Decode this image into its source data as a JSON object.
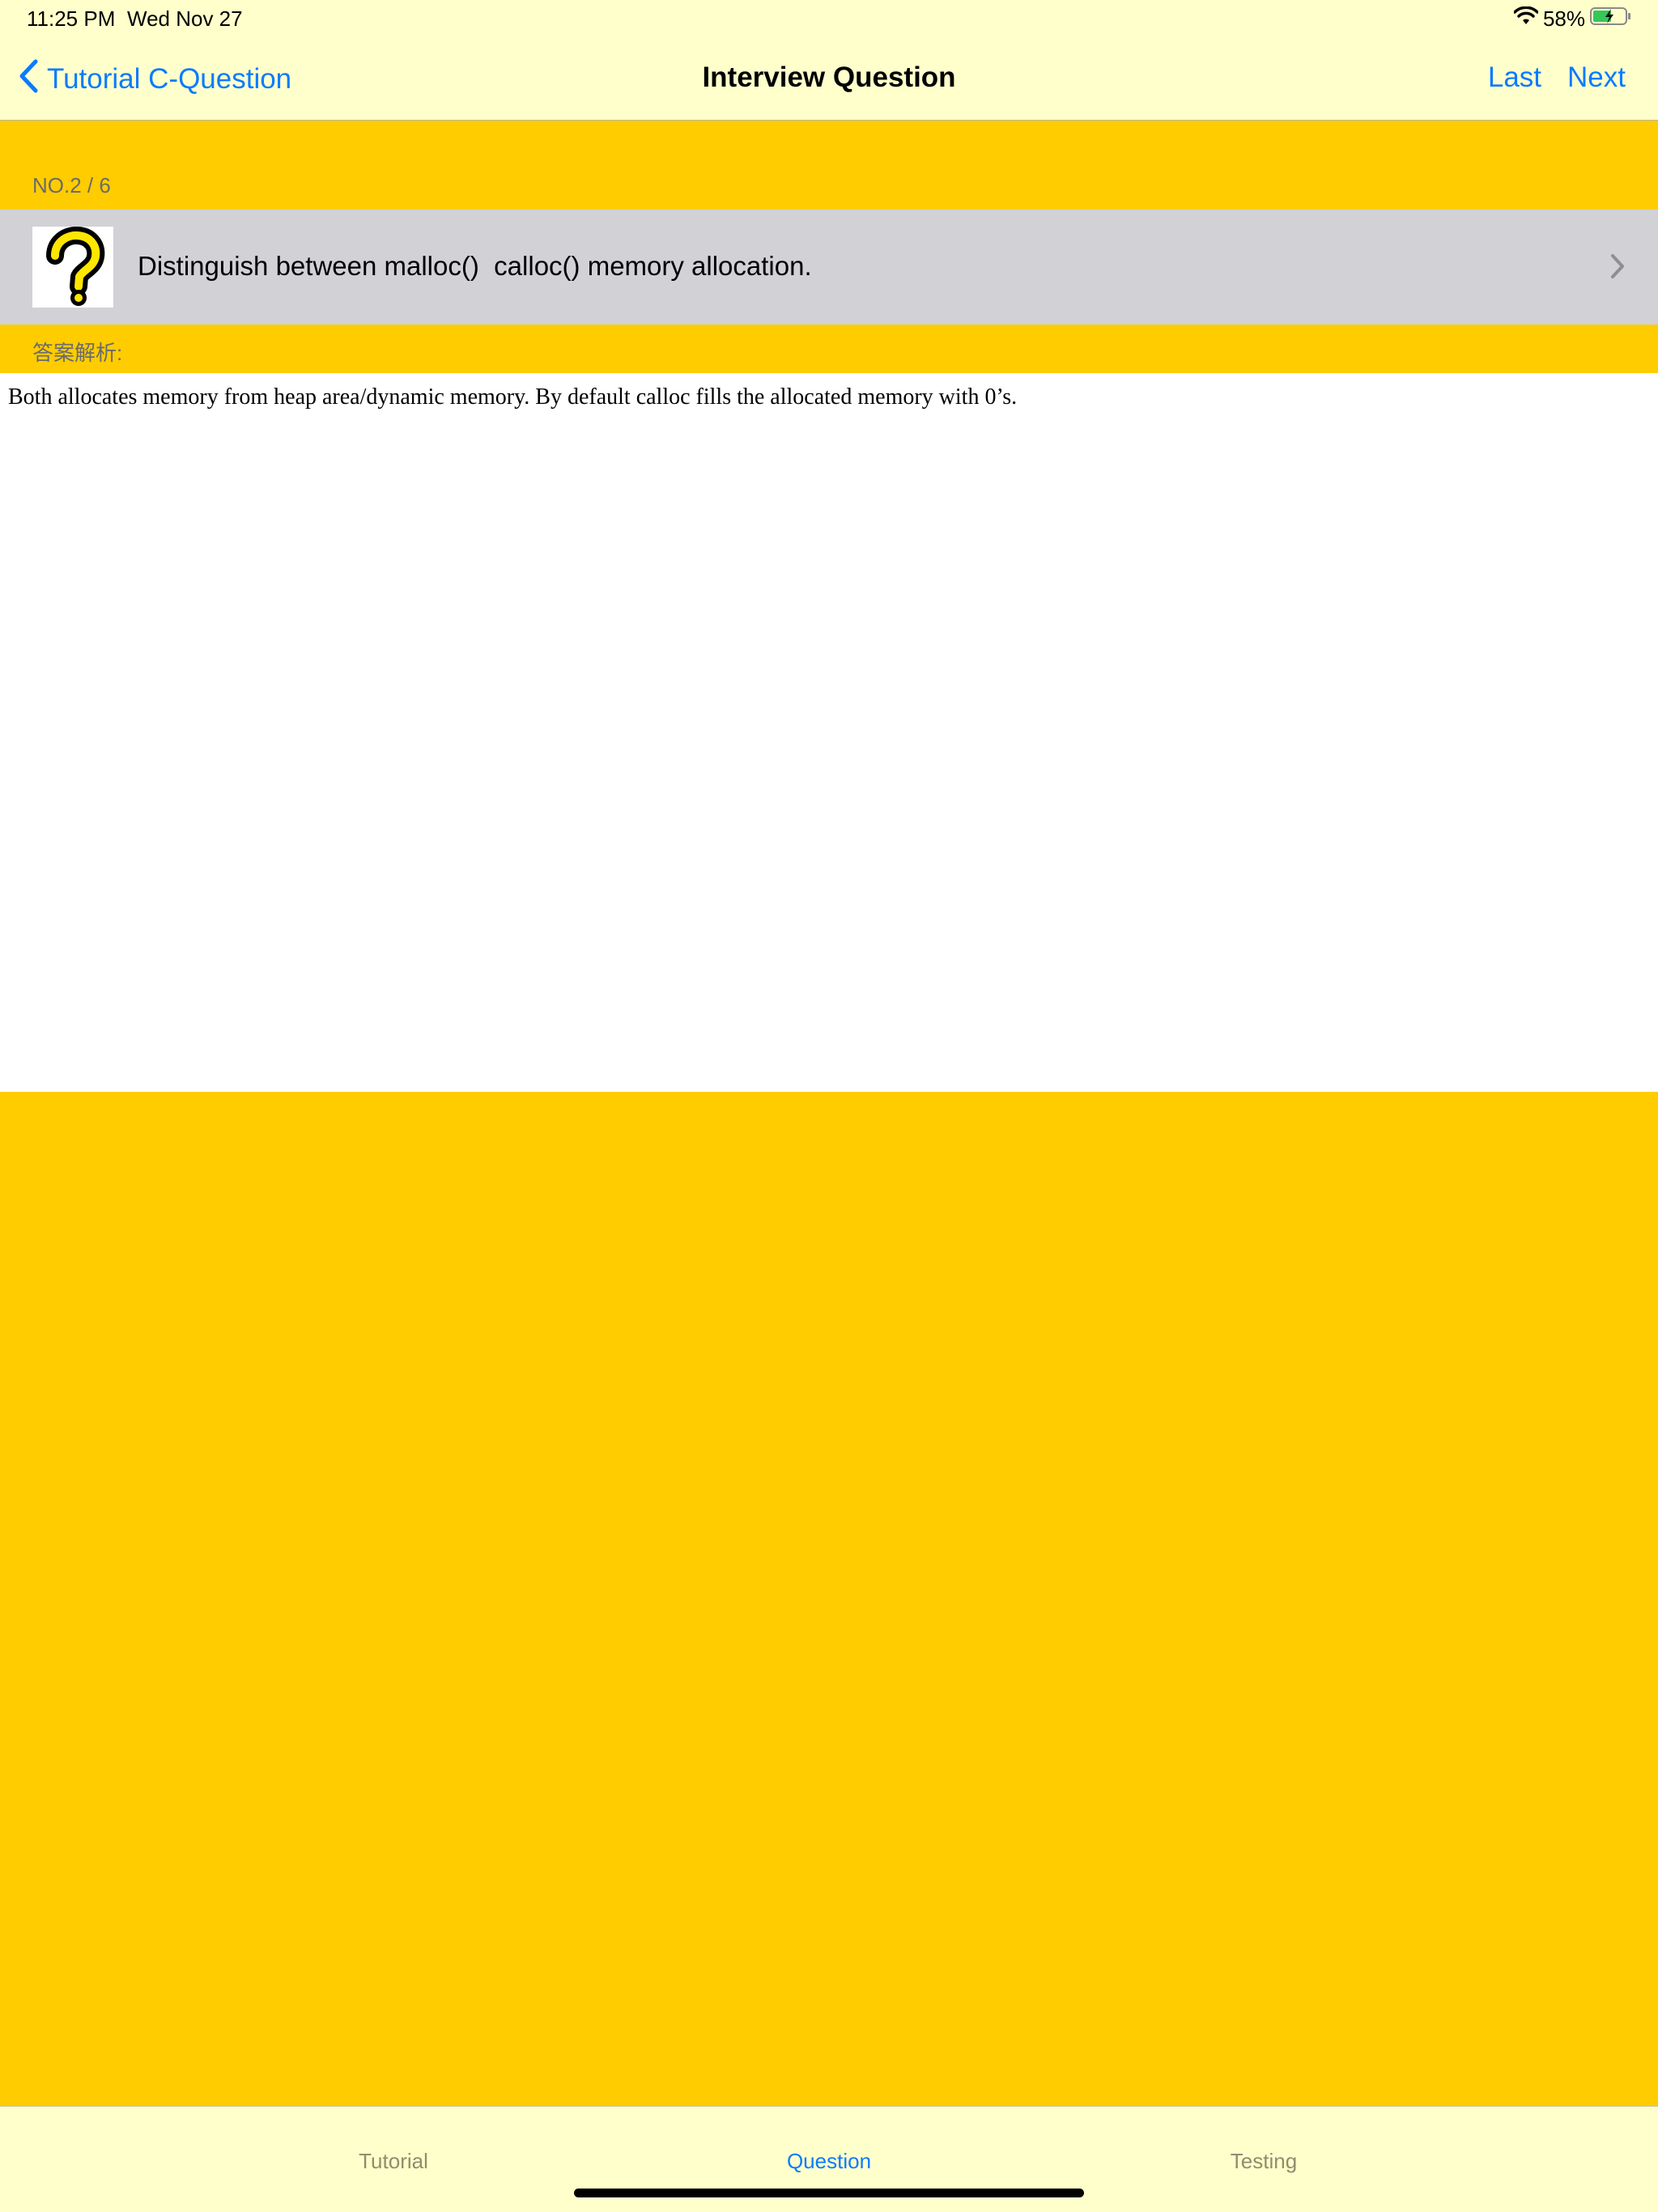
{
  "status": {
    "time": "11:25 PM",
    "date": "Wed Nov 27",
    "battery": "58%"
  },
  "nav": {
    "back_label": "Tutorial C-Question",
    "title": "Interview Question",
    "last_label": "Last",
    "next_label": "Next"
  },
  "question": {
    "counter": "NO.2 / 6",
    "text": "Distinguish between malloc()  calloc() memory allocation."
  },
  "answer": {
    "label": "答案解析:",
    "text": "Both allocates memory from heap area/dynamic memory. By default calloc fills the allocated memory with 0’s."
  },
  "tabs": [
    {
      "label": "Tutorial"
    },
    {
      "label": "Question"
    },
    {
      "label": "Testing"
    }
  ],
  "colors": {
    "bar_background": "#FFFFCC",
    "page_background": "#FFCC00",
    "accent": "#0A7BFF",
    "row_background": "#D1D1D6"
  }
}
